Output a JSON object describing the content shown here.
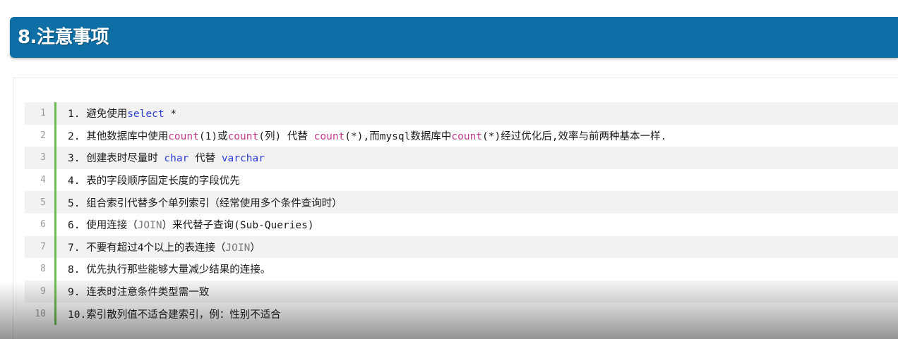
{
  "section": {
    "title": "8.注意事项"
  },
  "lines": [
    {
      "num": "1",
      "parts": [
        {
          "t": "1. 避免使用"
        },
        {
          "t": "select",
          "c": "kw"
        },
        {
          "t": " *"
        }
      ]
    },
    {
      "num": "2",
      "parts": [
        {
          "t": "2. 其他数据库中使用"
        },
        {
          "t": "count",
          "c": "fn"
        },
        {
          "t": "(1)或"
        },
        {
          "t": "count",
          "c": "fn"
        },
        {
          "t": "(列) 代替 "
        },
        {
          "t": "count",
          "c": "fn"
        },
        {
          "t": "(*),而mysql数据库中"
        },
        {
          "t": "count",
          "c": "fn"
        },
        {
          "t": "(*)经过优化后,效率与前两种基本一样."
        }
      ]
    },
    {
      "num": "3",
      "parts": [
        {
          "t": "3. 创建表时尽量时 "
        },
        {
          "t": "char",
          "c": "kw"
        },
        {
          "t": " 代替 "
        },
        {
          "t": "varchar",
          "c": "kw"
        }
      ]
    },
    {
      "num": "4",
      "parts": [
        {
          "t": "4. 表的字段顺序固定长度的字段优先"
        }
      ]
    },
    {
      "num": "5",
      "parts": [
        {
          "t": "5. 组合索引代替多个单列索引（经常使用多个条件查询时）"
        }
      ]
    },
    {
      "num": "6",
      "parts": [
        {
          "t": "6. 使用连接（"
        },
        {
          "t": "JOIN",
          "c": "muted"
        },
        {
          "t": "）来代替子查询(Sub-Queries)"
        }
      ]
    },
    {
      "num": "7",
      "parts": [
        {
          "t": "7. 不要有超过4个以上的表连接（"
        },
        {
          "t": "JOIN",
          "c": "muted"
        },
        {
          "t": "）"
        }
      ]
    },
    {
      "num": "8",
      "parts": [
        {
          "t": "8. 优先执行那些能够大量减少结果的连接。"
        }
      ]
    },
    {
      "num": "9",
      "parts": [
        {
          "t": "9. 连表时注意条件类型需一致"
        }
      ]
    },
    {
      "num": "10",
      "parts": [
        {
          "t": "10.索引散列值不适合建索引，例：性别不适合"
        }
      ]
    }
  ],
  "colors": {
    "header_bg": "#0e6fa6",
    "gutter_bar": "#6cbf4e",
    "keyword": "#2b3dd6",
    "function": "#c43a8a"
  }
}
